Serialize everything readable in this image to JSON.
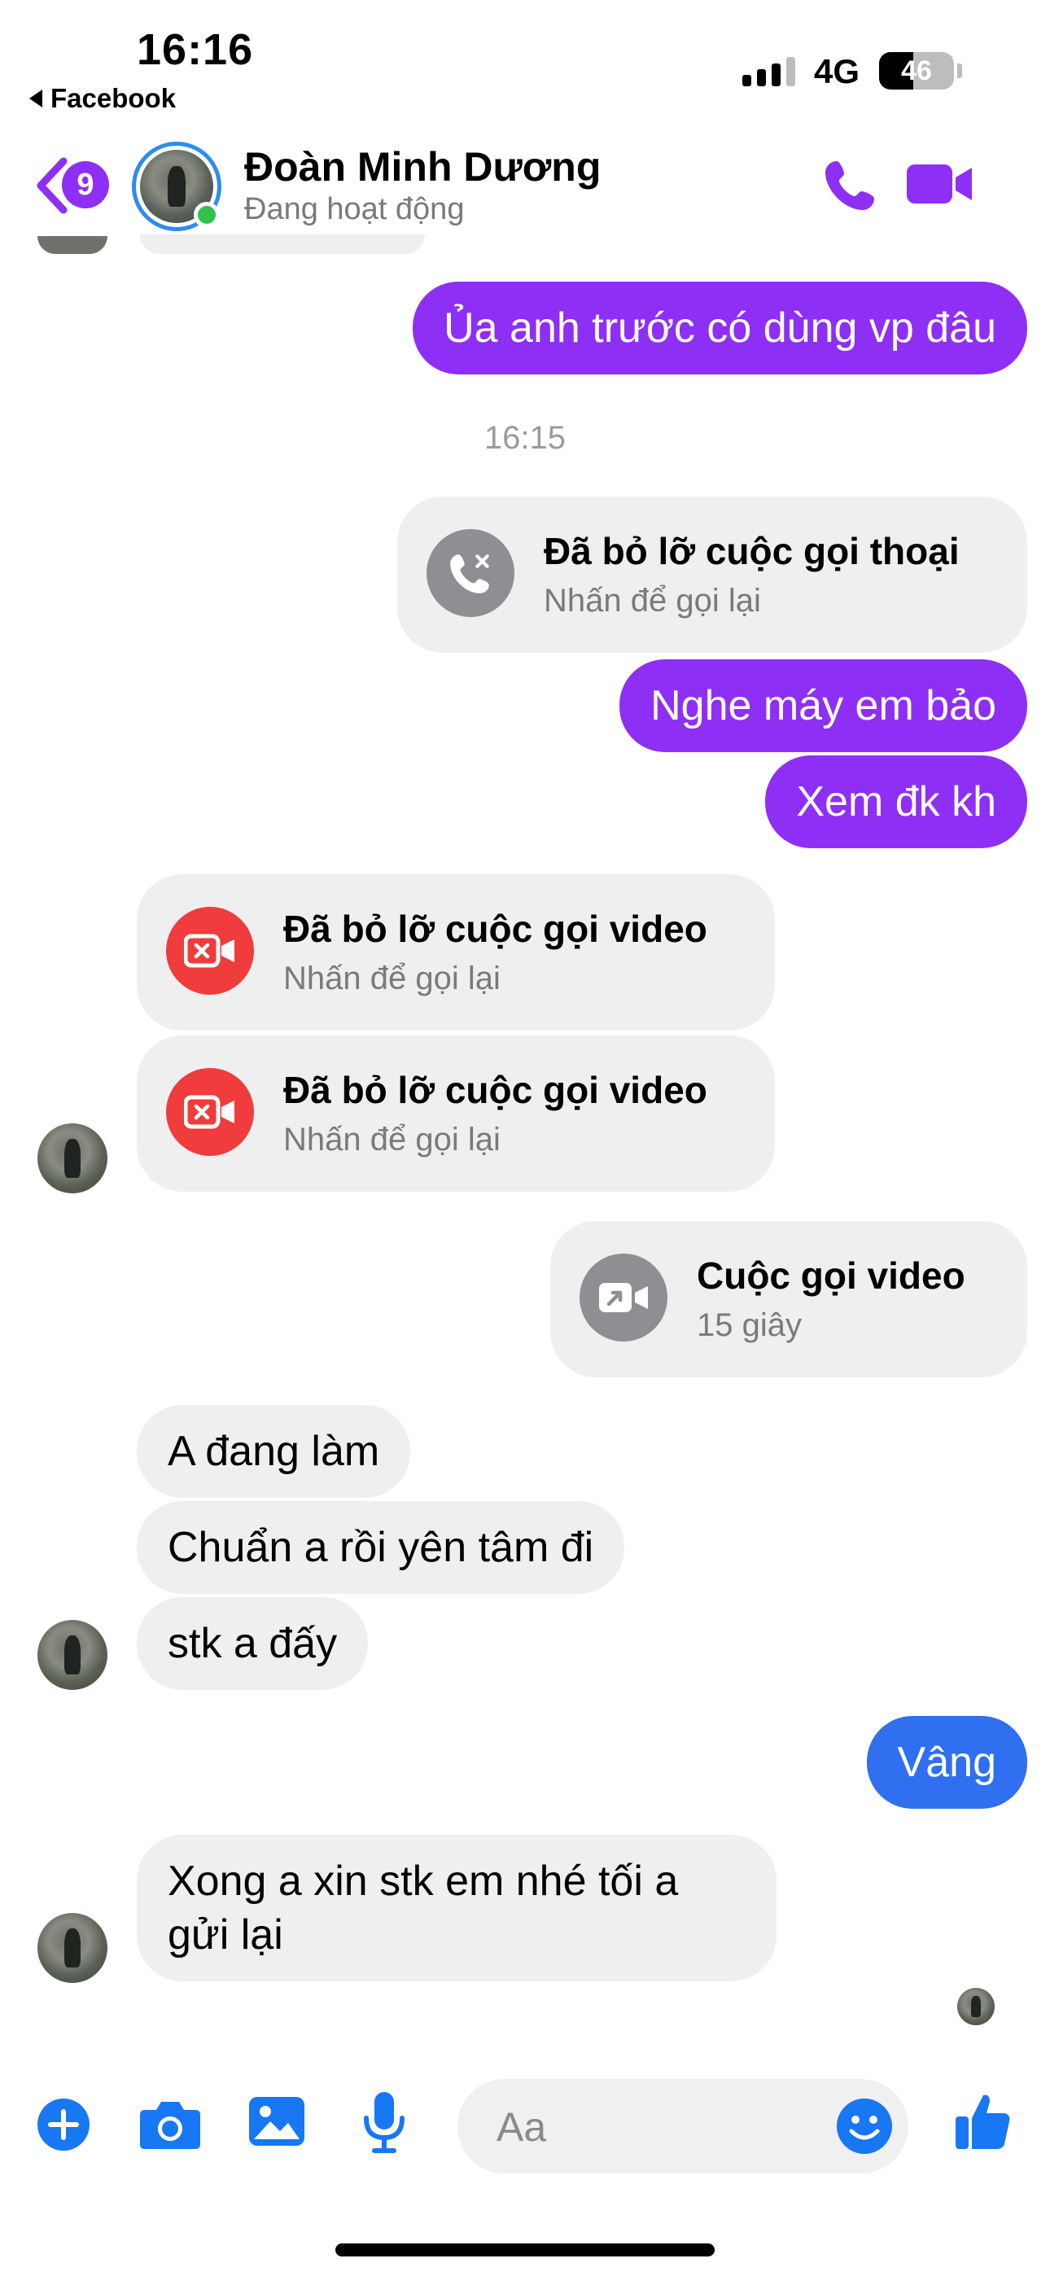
{
  "status_bar": {
    "time": "16:16",
    "back_app": "Facebook",
    "network": "4G",
    "battery": "46",
    "battery_level": 0.46
  },
  "header": {
    "unread_count": "9",
    "contact_name": "Đoàn Minh Dương",
    "contact_status": "Đang hoạt động",
    "accent_color": "#8e2ff5",
    "online_color": "#31c24d"
  },
  "messages": {
    "m1": "Ủa anh trước có dùng vp đâu",
    "timestamp": "16:15",
    "missed_voice_title": "Đã bỏ lỡ cuộc gọi thoại",
    "missed_voice_sub": "Nhấn để gọi lại",
    "m2": "Nghe máy em bảo",
    "m3": "Xem đk kh",
    "missed_video1_title": "Đã bỏ lỡ cuộc gọi video",
    "missed_video1_sub": "Nhấn để gọi lại",
    "missed_video2_title": "Đã bỏ lỡ cuộc gọi video",
    "missed_video2_sub": "Nhấn để gọi lại",
    "video_call_title": "Cuộc gọi video",
    "video_call_sub": "15 giây",
    "r1": "A đang làm",
    "r2": "Chuẩn a rồi yên tâm đi",
    "r3": "stk a đấy",
    "m4": "Vâng",
    "r4": "Xong a xin stk em nhé tối a gửi lại"
  },
  "composer": {
    "placeholder": "Aa",
    "icons": [
      "plus-icon",
      "camera-icon",
      "image-icon",
      "microphone-icon",
      "emoji-icon",
      "like-icon"
    ]
  }
}
